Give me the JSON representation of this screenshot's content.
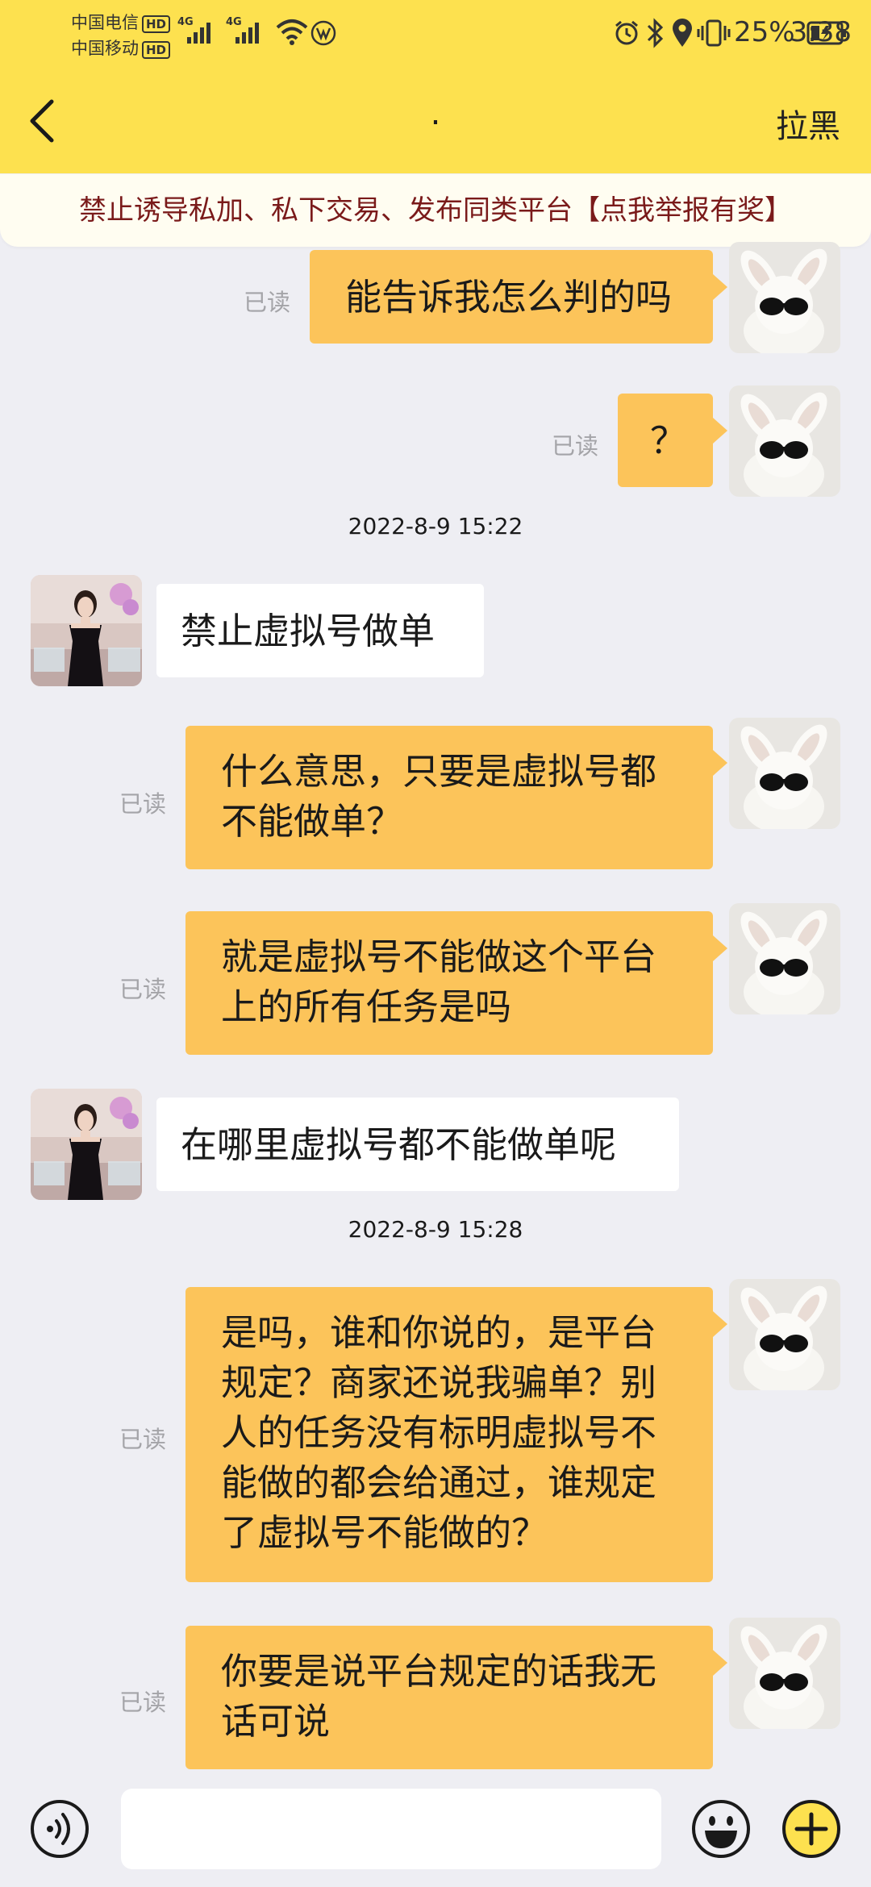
{
  "status_bar": {
    "carrier1": "中国电信",
    "carrier2": "中国移动",
    "hd": "HD",
    "network": "4G",
    "battery": "25%",
    "time": "3:38"
  },
  "nav": {
    "title": ".",
    "block_label": "拉黑"
  },
  "notice": "禁止诱导私加、私下交易、发布同类平台【点我举报有奖】",
  "read_label": "已读",
  "messages": [
    {
      "from": "me",
      "text": "能告诉我怎么判的吗"
    },
    {
      "from": "me",
      "text": "？"
    },
    {
      "type": "time",
      "text": "2022-8-9 15:22"
    },
    {
      "from": "other",
      "text": "禁止虚拟号做单"
    },
    {
      "from": "me",
      "line1": "什么意思，只要是虚拟号都",
      "line2": "不能做单？"
    },
    {
      "from": "me",
      "line1": "就是虚拟号不能做这个平台",
      "line2": "上的所有任务是吗"
    },
    {
      "from": "other",
      "text": "在哪里虚拟号都不能做单呢"
    },
    {
      "type": "time",
      "text": "2022-8-9 15:28"
    },
    {
      "from": "me",
      "lines": [
        "是吗，谁和你说的，是平台",
        "规定？商家还说我骗单？别",
        "人的任务没有标明虚拟号不",
        "能做的都会给通过，谁规定",
        "了虚拟号不能做的？"
      ]
    },
    {
      "from": "me",
      "line1": "你要是说平台规定的话我无",
      "line2": "话可说"
    }
  ],
  "input": {
    "placeholder": ""
  },
  "icons": {
    "back": "chevron-left-icon",
    "voice": "voice-icon",
    "emoji": "emoji-icon",
    "add": "plus-icon"
  },
  "colors": {
    "header": "#fde14f",
    "my_bubble": "#fcc45a",
    "other_bubble": "#ffffff",
    "notice_text": "#7a1a1a",
    "background": "#eeeef3"
  }
}
